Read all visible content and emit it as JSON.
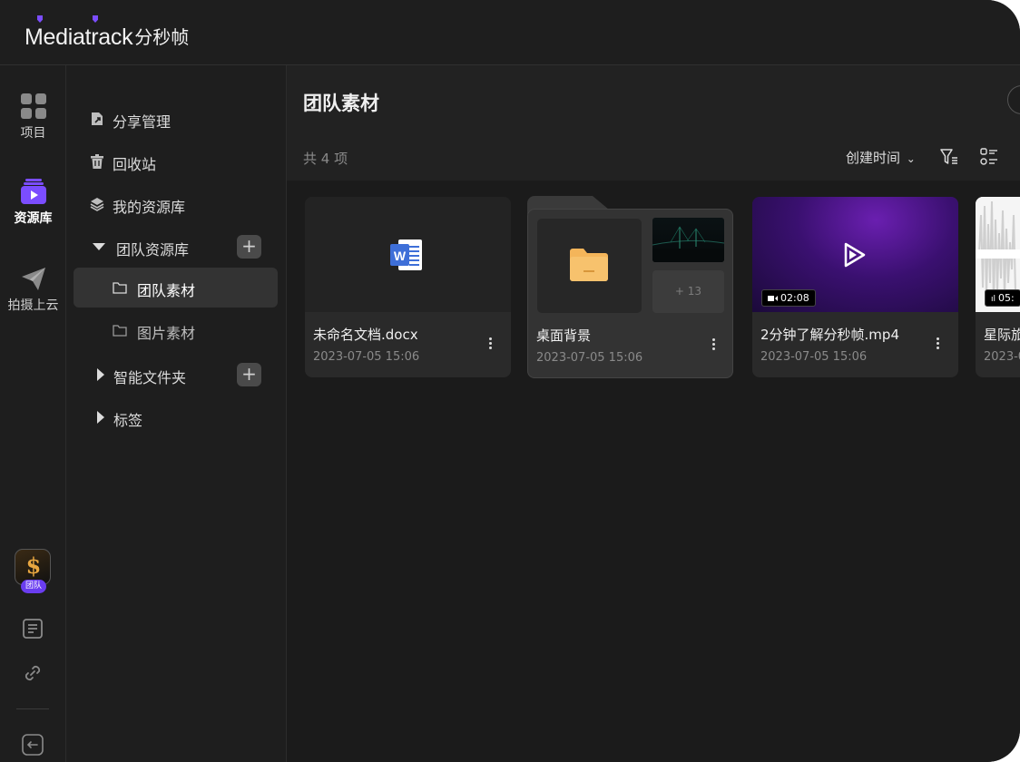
{
  "app": {
    "brand": "Mediatrack",
    "brand_cn": "分秒帧"
  },
  "rail": {
    "items": [
      {
        "label": "项目",
        "icon": "projects-grid-icon"
      },
      {
        "label": "资源库",
        "icon": "library-play-icon",
        "active": true
      },
      {
        "label": "拍摄上云",
        "icon": "cloud-upload-plane-icon"
      }
    ],
    "avatar_symbol": "$",
    "team_badge": "团队"
  },
  "sidebar": {
    "items": [
      {
        "label": "分享管理",
        "icon": "share-manage-icon"
      },
      {
        "label": "回收站",
        "icon": "trash-icon"
      },
      {
        "label": "我的资源库",
        "icon": "layers-icon"
      },
      {
        "label": "团队资源库",
        "icon": "caret-down-icon",
        "expanded": true,
        "has_add": true
      },
      {
        "label": "团队素材",
        "icon": "folder-outline-icon",
        "selected": true
      },
      {
        "label": "图片素材",
        "icon": "folder-outline-icon"
      },
      {
        "label": "智能文件夹",
        "icon": "caret-right-icon",
        "has_add": true
      },
      {
        "label": "标签",
        "icon": "caret-right-icon"
      }
    ],
    "add_label": "+"
  },
  "main": {
    "title": "团队素材",
    "count": "共 4 项",
    "sort_label": "创建时间",
    "sort_caret": "⌄",
    "cards": [
      {
        "name": "未命名文档.docx",
        "date": "2023-07-05 15:06",
        "kind": "word-doc"
      },
      {
        "name": "桌面背景",
        "date": "2023-07-05 15:06",
        "kind": "folder",
        "extra_count": "+ 13"
      },
      {
        "name": "2分钟了解分秒帧.mp4",
        "date": "2023-07-05 15:06",
        "kind": "video",
        "duration": "02:08"
      },
      {
        "name": "星际旅",
        "date": "2023-0",
        "kind": "audio",
        "duration": "05:"
      }
    ]
  },
  "colors": {
    "accent": "#6a3df0",
    "background": "#1c1c1c",
    "panel": "#1e1e1e",
    "card": "#2a2a2a",
    "word_blue": "#3e6fd8",
    "folder_yellow": "#f4b55a"
  }
}
